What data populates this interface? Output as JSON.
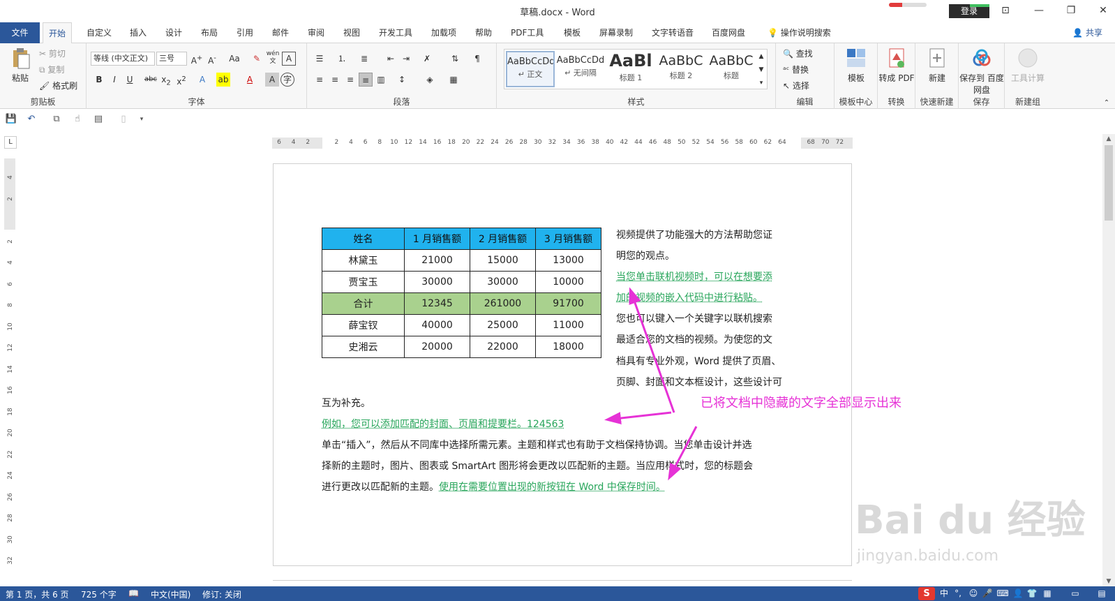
{
  "window": {
    "title": "草稿.docx  -  Word",
    "login_label": "登录",
    "progress": 0.35
  },
  "tabs": {
    "file": "文件",
    "items": [
      "开始",
      "自定义",
      "插入",
      "设计",
      "布局",
      "引用",
      "邮件",
      "审阅",
      "视图",
      "开发工具",
      "加载项",
      "帮助",
      "PDF工具",
      "模板",
      "屏幕录制",
      "文字转语音",
      "百度网盘"
    ],
    "active": "开始",
    "tell_me": "操作说明搜索",
    "share": "共享"
  },
  "ribbon": {
    "clipboard": {
      "paste": "粘贴",
      "cut": "剪切",
      "copy": "复制",
      "format_painter": "格式刷",
      "label": "剪贴板"
    },
    "font": {
      "font_name": "等线 (中文正文)",
      "font_size": "三号",
      "label": "字体",
      "case": "Aa",
      "phonetic": "wén"
    },
    "paragraph": {
      "label": "段落"
    },
    "styles": {
      "label": "样式",
      "items": [
        {
          "preview": "AaBbCcDd",
          "name": "↵ 正文"
        },
        {
          "preview": "AaBbCcDd",
          "name": "↵ 无间隔"
        },
        {
          "preview": "AaBl",
          "name": "标题 1"
        },
        {
          "preview": "AaBbC",
          "name": "标题 2"
        },
        {
          "preview": "AaBbC",
          "name": "标题"
        }
      ]
    },
    "editing": {
      "find": "查找",
      "replace": "替换",
      "select": "选择",
      "label": "编辑"
    },
    "template": {
      "btn": "模板",
      "label": "模板中心"
    },
    "convert": {
      "btn": "转成 PDF",
      "label": "转换"
    },
    "quicknew": {
      "btn": "新建",
      "label": "快速新建"
    },
    "save": {
      "btn": "保存到 百度网盘",
      "label": "保存"
    },
    "newgroup": {
      "btn": "工具计算",
      "label": "新建组"
    }
  },
  "ruler": {
    "h_ticks": [
      "6",
      "4",
      "2",
      "",
      "2",
      "4",
      "6",
      "8",
      "10",
      "12",
      "14",
      "16",
      "18",
      "20",
      "22",
      "24",
      "26",
      "28",
      "30",
      "32",
      "34",
      "36",
      "38",
      "40",
      "42",
      "44",
      "46",
      "48",
      "50",
      "52",
      "54",
      "56",
      "58",
      "60",
      "62",
      "64",
      "",
      "68",
      "70",
      "72"
    ],
    "v_ticks": [
      "4",
      "2",
      "",
      "2",
      "4",
      "6",
      "8",
      "10",
      "12",
      "14",
      "16",
      "18",
      "20",
      "22",
      "24",
      "26",
      "28",
      "30",
      "32"
    ],
    "corner": "L"
  },
  "table": {
    "headers": [
      "姓名",
      "1 月销售额",
      "2 月销售额",
      "3 月销售额"
    ],
    "rows": [
      [
        "林黛玉",
        "21000",
        "15000",
        "13000"
      ],
      [
        "贾宝玉",
        "30000",
        "30000",
        "10000"
      ],
      [
        "合计",
        "12345",
        "261000",
        "91700"
      ],
      [
        "薛宝钗",
        "40000",
        "25000",
        "11000"
      ],
      [
        "史湘云",
        "20000",
        "22000",
        "18000"
      ]
    ],
    "header_color": "#20b2ee",
    "sum_color": "#a9d18e"
  },
  "doc": {
    "r1": "视频提供了功能强大的方法帮助您证",
    "r2": "明您的观点。",
    "r3": "当您单击联机视频时，可以在想要添",
    "r4": "加的视频的嵌入代码中进行粘贴。",
    "r5": "您也可以键入一个关键字以联机搜索",
    "r6": "最适合您的文档的视频。为使您的文",
    "r7": "档具有专业外观，Word 提供了页眉、",
    "r8": "页脚、封面和文本框设计，这些设计可",
    "l1": "互为补充。",
    "l2": "例如，您可以添加匹配的封面、页眉和提要栏。124563",
    "l3": "单击“插入”，然后从不同库中选择所需元素。主题和样式也有助于文档保持协调。当您单击设计并选",
    "l4": "择新的主题时，图片、图表或 SmartArt 图形将会更改以匹配新的主题。当应用样式时，您的标题会",
    "l5a": "进行更改以匹配新的主题。",
    "l5b": "使用在需要位置出现的新按钮在 Word 中保存时间。",
    "hidden_color": "#27a55a"
  },
  "annotation": {
    "text": "已将文档中隐藏的文字全部显示出来",
    "color": "#e632d6"
  },
  "watermark": {
    "brand": "Bai  du 经验",
    "url": "jingyan.baidu.com"
  },
  "status": {
    "page": "第 1 页，共 6 页",
    "words": "725 个字",
    "language": "中文(中国)",
    "track": "修订: 关闭",
    "ime_logo": "S",
    "ime_lang": "中"
  }
}
